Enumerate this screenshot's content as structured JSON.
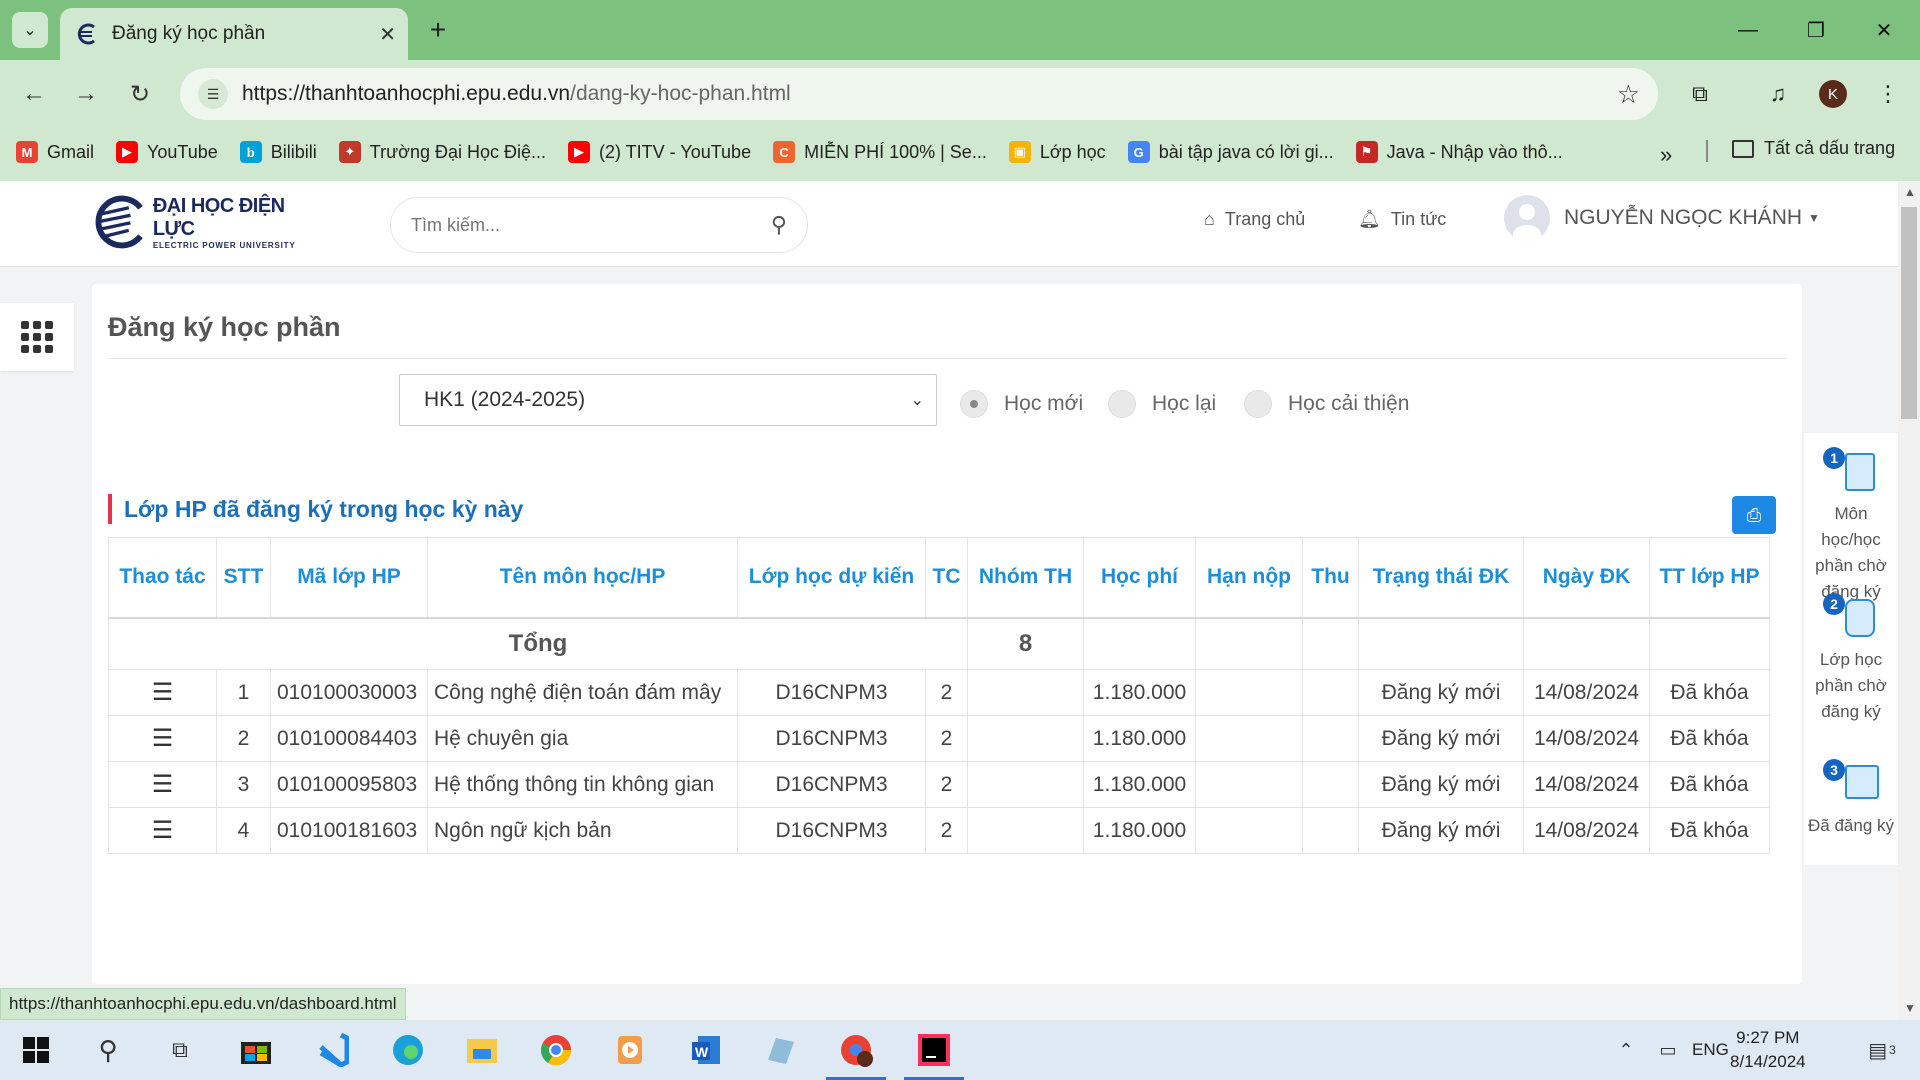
{
  "browser": {
    "tab_title": "Đăng ký học phần",
    "url_host": "https://thanhtoanhocphi.epu.edu.vn",
    "url_path": "/dang-ky-hoc-phan.html",
    "profile_initial": "K",
    "bookmarks": [
      {
        "label": "Gmail",
        "icon": "gmail-icon",
        "color": "#ea4335"
      },
      {
        "label": "YouTube",
        "icon": "youtube-icon",
        "color": "#ff0000"
      },
      {
        "label": "Bilibili",
        "icon": "bilibili-icon",
        "color": "#00a1d6"
      },
      {
        "label": "Trường Đại Học Điệ...",
        "icon": "epu-icon",
        "color": "#c0392b"
      },
      {
        "label": "(2) TITV - YouTube",
        "icon": "youtube-icon",
        "color": "#ff0000"
      },
      {
        "label": "MIỄN PHÍ 100% | Se...",
        "icon": "c-icon",
        "color": "#f06430"
      },
      {
        "label": "Lớp học",
        "icon": "classroom-icon",
        "color": "#f4b400"
      },
      {
        "label": "bài tập java có lời gi...",
        "icon": "google-icon",
        "color": "#4285f4"
      },
      {
        "label": "Java - Nhập vào thô...",
        "icon": "java-flag-icon",
        "color": "#c62828"
      }
    ],
    "all_bookmarks": "Tất cả dấu trang",
    "status_url": "https://thanhtoanhocphi.epu.edu.vn/dashboard.html"
  },
  "header": {
    "logo_line1": "ĐẠI HỌC ĐIỆN LỰC",
    "logo_line2": "ELECTRIC POWER UNIVERSITY",
    "search_placeholder": "Tìm kiếm...",
    "nav_home": "Trang chủ",
    "nav_news": "Tin tức",
    "user_name": "NGUYỄN NGỌC KHÁNH"
  },
  "main": {
    "title": "Đăng ký học phần",
    "semester": "HK1 (2024-2025)",
    "radios": [
      {
        "label": "Học mới",
        "checked": true
      },
      {
        "label": "Học lại",
        "checked": false
      },
      {
        "label": "Học cải thiện",
        "checked": false
      }
    ],
    "section_title": "Lớp HP đã đăng ký trong học kỳ này",
    "columns": [
      "Thao tác",
      "STT",
      "Mã lớp HP",
      "Tên môn học/HP",
      "Lớp học dự kiến",
      "TC",
      "Nhóm TH",
      "Học phí",
      "Hạn nộp",
      "Thu",
      "Trạng thái ĐK",
      "Ngày ĐK",
      "TT lớp HP"
    ],
    "total_label": "Tổng",
    "total_credits": "8",
    "rows": [
      [
        "1",
        "010100030003",
        "Công nghệ điện toán đám mây",
        "D16CNPM3",
        "2",
        "",
        "1.180.000",
        "",
        "",
        "Đăng ký mới",
        "14/08/2024",
        "Đã khóa"
      ],
      [
        "2",
        "010100084403",
        "Hệ chuyên gia",
        "D16CNPM3",
        "2",
        "",
        "1.180.000",
        "",
        "",
        "Đăng ký mới",
        "14/08/2024",
        "Đã khóa"
      ],
      [
        "3",
        "010100095803",
        "Hệ thống thông tin không gian",
        "D16CNPM3",
        "2",
        "",
        "1.180.000",
        "",
        "",
        "Đăng ký mới",
        "14/08/2024",
        "Đã khóa"
      ],
      [
        "4",
        "010100181603",
        "Ngôn ngữ kịch bản",
        "D16CNPM3",
        "2",
        "",
        "1.180.000",
        "",
        "",
        "Đăng ký mới",
        "14/08/2024",
        "Đã khóa"
      ]
    ]
  },
  "side_panel": [
    {
      "num": "1",
      "label": "Môn học/học phần chờ đăng ký"
    },
    {
      "num": "2",
      "label": "Lớp học phần chờ đăng ký"
    },
    {
      "num": "3",
      "label": "Đã đăng ký"
    }
  ],
  "taskbar": {
    "language": "ENG",
    "time": "9:27 PM",
    "date": "8/14/2024",
    "notification_count": "3"
  }
}
